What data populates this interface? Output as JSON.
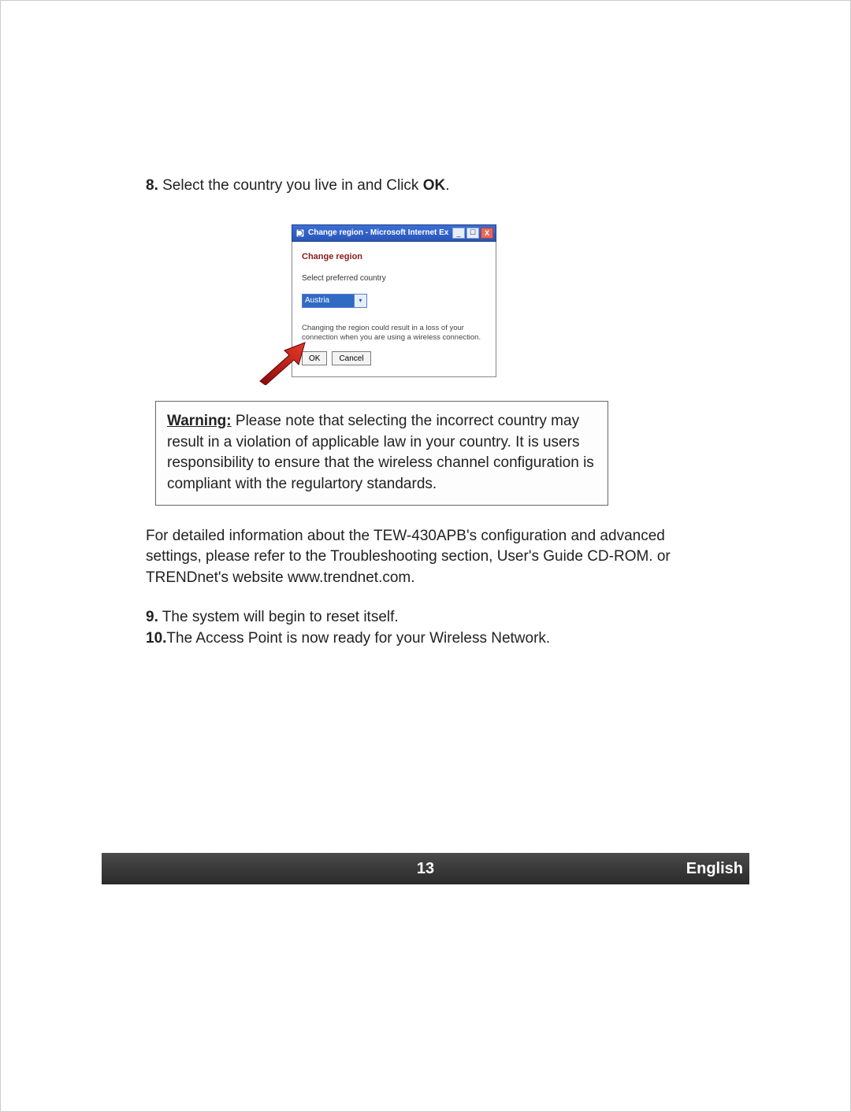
{
  "step8": {
    "num": "8.",
    "text_before": " Select the country you live in and Click ",
    "bold": "OK",
    "text_after": "."
  },
  "dialog": {
    "title": "Change region - Microsoft Internet Ex…",
    "heading": "Change region",
    "label": "Select preferred country",
    "selected": "Austria",
    "note": "Changing the region could result in a loss of your connection when you are using a wireless connection.",
    "ok": "OK",
    "cancel": "Cancel"
  },
  "warning": {
    "label": "Warning:",
    "text": " Please note that selecting the incorrect country may result in a violation of applicable law in your country. It is users responsibility to ensure that the wireless channel configuration is compliant with the regulartory standards."
  },
  "para": "For detailed information about the TEW-430APB's configuration and advanced settings, please refer to the Troubleshooting section, User's Guide CD-ROM. or TRENDnet's website www.trendnet.com.",
  "step9": {
    "num": "9.",
    "text": "  The system will begin to reset itself."
  },
  "step10": {
    "num": "10.",
    "text": "The Access Point is now ready for your Wireless Network."
  },
  "footer": {
    "page": "13",
    "lang": "English"
  }
}
